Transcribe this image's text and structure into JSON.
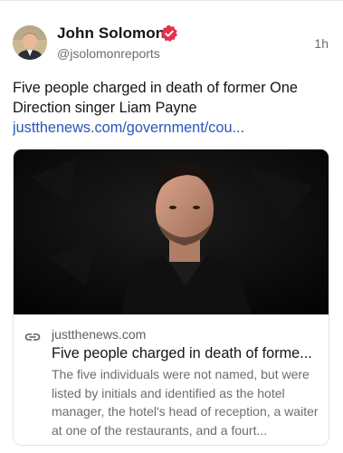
{
  "post": {
    "author": {
      "name": "John Solomon",
      "handle": "@jsolomonreports",
      "verified": true,
      "avatar": "profile-photo"
    },
    "time": "1h",
    "text": "Five people charged in death of former One Direction singer Liam Payne",
    "link": "justthenews.com/government/cou..."
  },
  "card": {
    "image": "portrait-photo",
    "domain": "justthenews.com",
    "title": "Five people charged in death of forme...",
    "description": "The five individuals were not named, but were listed by initials and identified as the hotel manager, the hotel's head of reception, a waiter at one of the restaurants, and a fourt..."
  },
  "colors": {
    "link": "#2a55b8",
    "verified_badge": "#e4314f",
    "muted_text": "#6d6d6d"
  }
}
